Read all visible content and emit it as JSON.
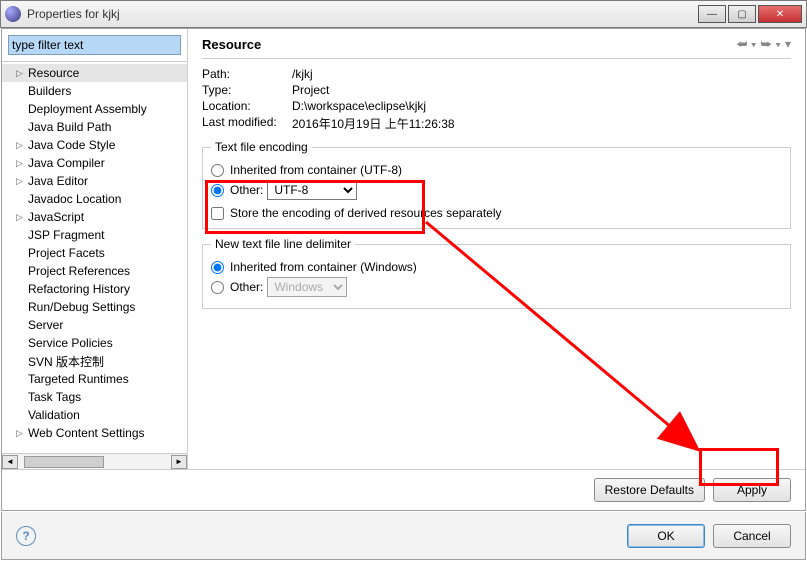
{
  "window": {
    "title": "Properties for kjkj"
  },
  "filter": {
    "value": "type filter text"
  },
  "tree": [
    {
      "label": "Resource",
      "expand": "▷",
      "sel": true
    },
    {
      "label": "Builders",
      "expand": ""
    },
    {
      "label": "Deployment Assembly",
      "expand": ""
    },
    {
      "label": "Java Build Path",
      "expand": ""
    },
    {
      "label": "Java Code Style",
      "expand": "▷"
    },
    {
      "label": "Java Compiler",
      "expand": "▷"
    },
    {
      "label": "Java Editor",
      "expand": "▷"
    },
    {
      "label": "Javadoc Location",
      "expand": ""
    },
    {
      "label": "JavaScript",
      "expand": "▷"
    },
    {
      "label": "JSP Fragment",
      "expand": ""
    },
    {
      "label": "Project Facets",
      "expand": ""
    },
    {
      "label": "Project References",
      "expand": ""
    },
    {
      "label": "Refactoring History",
      "expand": ""
    },
    {
      "label": "Run/Debug Settings",
      "expand": ""
    },
    {
      "label": "Server",
      "expand": ""
    },
    {
      "label": "Service Policies",
      "expand": ""
    },
    {
      "label": "SVN 版本控制",
      "expand": ""
    },
    {
      "label": "Targeted Runtimes",
      "expand": ""
    },
    {
      "label": "Task Tags",
      "expand": ""
    },
    {
      "label": "Validation",
      "expand": ""
    },
    {
      "label": "Web Content Settings",
      "expand": "▷"
    }
  ],
  "page": {
    "heading": "Resource",
    "props": {
      "pathLabel": "Path:",
      "pathValue": "/kjkj",
      "typeLabel": "Type:",
      "typeValue": "Project",
      "locLabel": "Location:",
      "locValue": "D:\\workspace\\eclipse\\kjkj",
      "modLabel": "Last modified:",
      "modValue": "2016年10月19日 上午11:26:38"
    },
    "encoding": {
      "legend": "Text file encoding",
      "inheritLabel": "Inherited from container (UTF-8)",
      "otherLabel": "Other:",
      "otherValue": "UTF-8",
      "storeLabel": "Store the encoding of derived resources separately"
    },
    "delim": {
      "legend": "New text file line delimiter",
      "inheritLabel": "Inherited from container (Windows)",
      "otherLabel": "Other:",
      "otherValue": "Windows"
    },
    "buttons": {
      "restore": "Restore Defaults",
      "apply": "Apply",
      "ok": "OK",
      "cancel": "Cancel"
    }
  }
}
